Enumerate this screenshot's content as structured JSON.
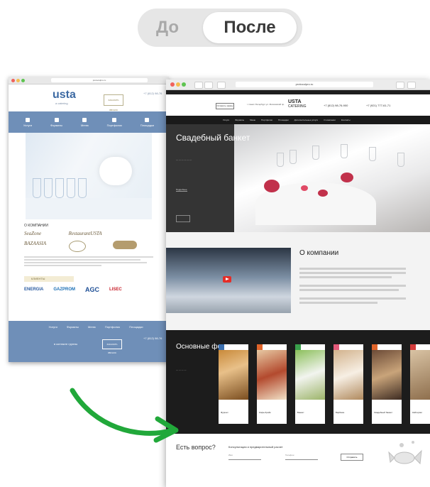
{
  "toggle": {
    "before": "До",
    "after": "После"
  },
  "old_site": {
    "url": "protocolpro.ru",
    "logo": "usta",
    "logo_sub": "a catering",
    "call_button": "ЗАКАЗАТЬ ЗВОНОК",
    "phone": "+7 (812) 98-76",
    "nav": [
      "Услуги",
      "Форматы",
      "Меню",
      "Портфолио",
      "Площадки"
    ],
    "partners_heading": "О КОМПАНИИ",
    "brands": [
      "SeaZone",
      "RestaurantUSTA",
      "BAZAASIA"
    ],
    "clients_label": "КЛИЕНТЫ",
    "clients": [
      "ENERGIA",
      "GAZPROM",
      "AGC",
      "LISEC"
    ],
    "footer_nav": [
      "Услуги",
      "Форматы",
      "Меню",
      "Портфолио",
      "Площадки"
    ],
    "footer_button": "ЗАКАЗАТЬ ЗВОНОК",
    "footer_phone": "+7 (812) 98-76",
    "footer_brand": "в контакте группы"
  },
  "new_site": {
    "url": "protocolpro.ru",
    "header_link": "Оставить заявку",
    "address": "г. Санкт-Петербург ул. Московский пр.",
    "logo_top": "USTA",
    "logo_bottom": "CATERING",
    "phone_1": "+7 (812) 98-76-900",
    "phone_2": "+7 (921) 777-61-71",
    "nav": [
      "Услуги",
      "Форматы",
      "Меню",
      "Портфолио",
      "Площадки",
      "Дополнительные услуги",
      "О компании",
      "Контакты"
    ],
    "hero_title": "Свадебный банкет",
    "hero_more": "Подробнее",
    "about_title": "О компании",
    "formats_title": "Основные форматы",
    "format_cards": [
      "Фуршет",
      "Кофе-брейк",
      "Банкет",
      "Барбекю",
      "Свадебный банкет",
      "Кейтеринг",
      "Выездной"
    ],
    "ask_title": "Есть вопрос?",
    "ask_prompt": "Консультация и предварительный расчет",
    "ask_name": "Имя",
    "ask_phone": "Телефон",
    "ask_send": "Отправить"
  },
  "colors": {
    "old_blue": "#6f8fb8",
    "dark": "#1c1c1c",
    "arrow": "#21a83a"
  }
}
